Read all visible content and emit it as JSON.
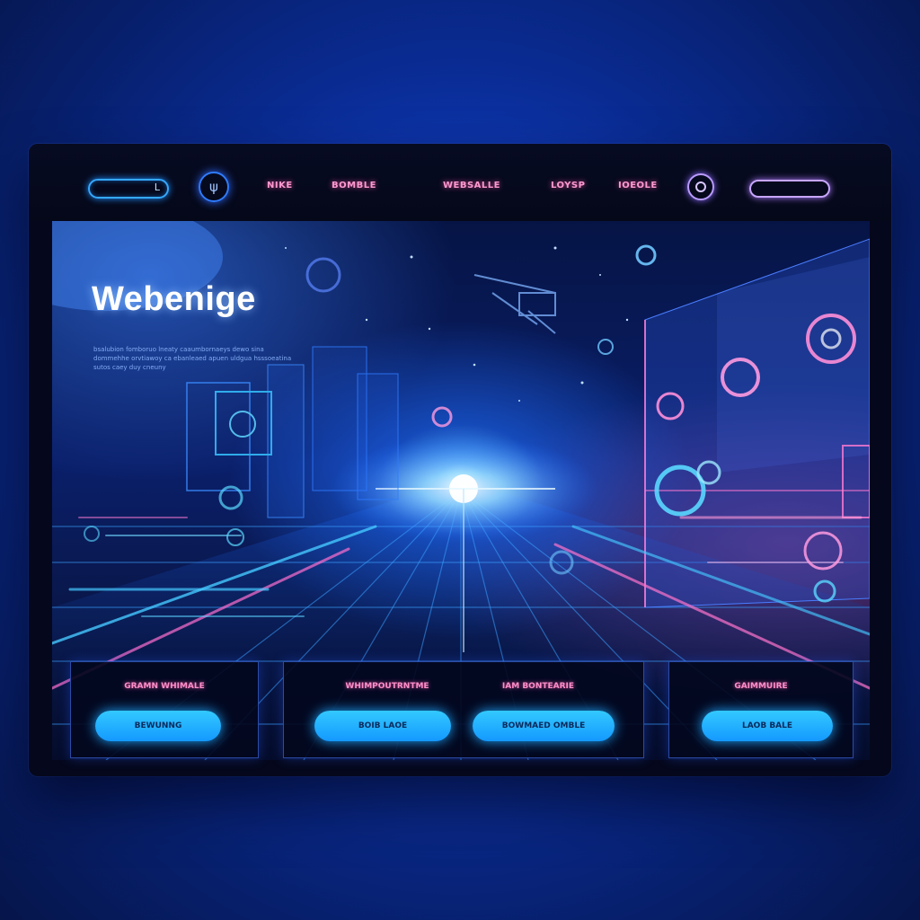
{
  "nav": {
    "search_glyph": "L",
    "logo_glyph": "ψ",
    "links": [
      "NIKE",
      "BOMBLE",
      "WEBSALLE",
      "LOYSP",
      "IOEOLE"
    ]
  },
  "hero": {
    "title": "Webenige",
    "description": "bsalubion fomboruo lneaty caaumbornaeys dewo sina dommehhe orvtiawoy ca ebanleaed apuen uldgua hsssoeatina sutos caey duy cneuny"
  },
  "cards": [
    {
      "title": "GRAMN WHIMALE",
      "buttons": [
        "BEWUNNG"
      ]
    },
    {
      "titles": [
        "WHIMPOUTRNTME",
        "IAM BONTEARIE"
      ],
      "buttons": [
        "BOIB LAOE",
        "BOWMAED OMBLE"
      ]
    },
    {
      "title": "GAIMMUIRE",
      "buttons": [
        "LAOB BALE"
      ]
    }
  ],
  "colors": {
    "accent_blue": "#1ea8ff",
    "accent_pink": "#ff8fc9",
    "accent_violet": "#b07cff",
    "window_bg": "#05081c"
  }
}
